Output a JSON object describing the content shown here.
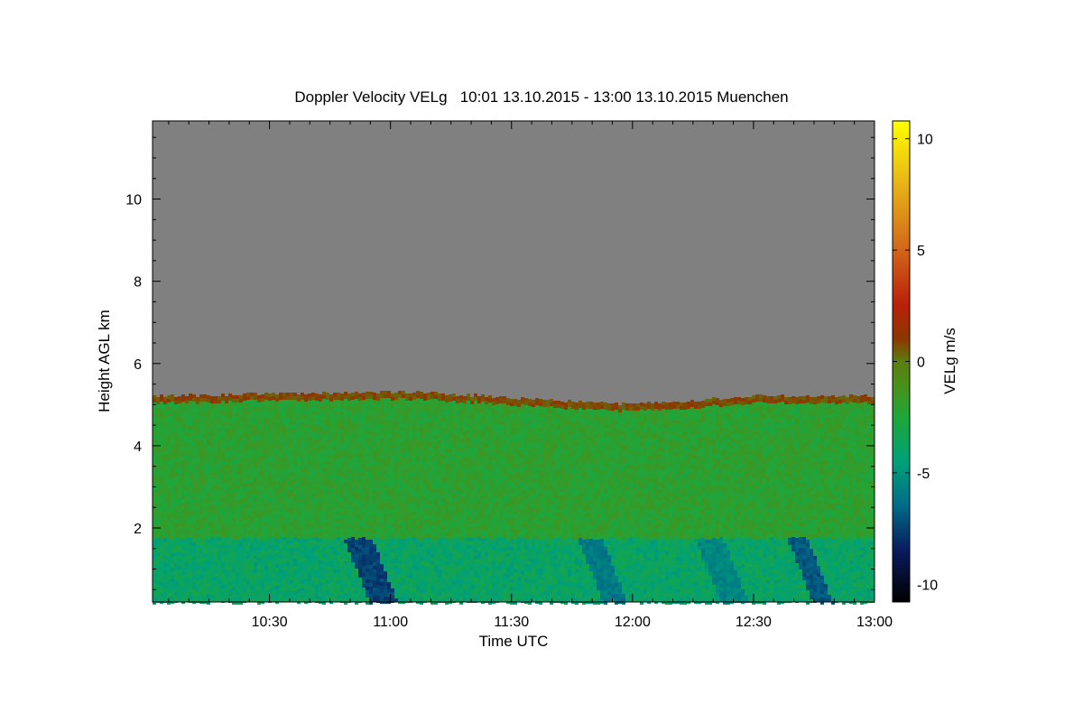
{
  "chart_data": {
    "type": "heatmap",
    "title": "Doppler Velocity VELg   10:01 13.10.2015 - 13:00 13.10.2015 Muenchen",
    "xlabel": "Time UTC",
    "ylabel": "Height AGL km",
    "xlim": [
      "10:01",
      "13:00"
    ],
    "ylim": [
      0.2,
      11.9
    ],
    "x_ticks": [
      "10:30",
      "11:00",
      "11:30",
      "12:00",
      "12:30",
      "13:00"
    ],
    "y_ticks": [
      2,
      4,
      6,
      8,
      10
    ],
    "grid": false,
    "colorbar": {
      "label": "VELg m/s",
      "range": [
        -10.8,
        10.8
      ],
      "ticks": [
        -10,
        -5,
        0,
        5,
        10
      ],
      "stops": [
        {
          "value": -10.8,
          "color": "#000000"
        },
        {
          "value": -8.5,
          "color": "#0a1a5e"
        },
        {
          "value": -6.5,
          "color": "#006a88"
        },
        {
          "value": -4.5,
          "color": "#00a178"
        },
        {
          "value": -2.5,
          "color": "#1fa63a"
        },
        {
          "value": -1.0,
          "color": "#4b8f18"
        },
        {
          "value": 0.0,
          "color": "#5a7d12"
        },
        {
          "value": 1.0,
          "color": "#8a3800"
        },
        {
          "value": 2.5,
          "color": "#b8200a"
        },
        {
          "value": 5.0,
          "color": "#d2651a"
        },
        {
          "value": 8.0,
          "color": "#e8b418"
        },
        {
          "value": 10.8,
          "color": "#ffff00"
        }
      ]
    },
    "no_data_color": "#808080",
    "echo_top_km": [
      {
        "time": "10:01",
        "top": 5.2
      },
      {
        "time": "10:30",
        "top": 5.25
      },
      {
        "time": "11:00",
        "top": 5.3
      },
      {
        "time": "11:15",
        "top": 5.25
      },
      {
        "time": "11:30",
        "top": 5.15
      },
      {
        "time": "12:00",
        "top": 5.0
      },
      {
        "time": "12:30",
        "top": 5.2
      },
      {
        "time": "13:00",
        "top": 5.2
      }
    ],
    "melting_layer_km": 1.8,
    "fall_streaks": [
      {
        "start": "10:48",
        "end": "10:55",
        "velocity": -8.0
      },
      {
        "start": "11:46",
        "end": "11:52",
        "velocity": -6.5
      },
      {
        "start": "12:15",
        "end": "12:22",
        "velocity": -6.0
      },
      {
        "start": "12:38",
        "end": "12:43",
        "velocity": -7.5
      }
    ]
  }
}
